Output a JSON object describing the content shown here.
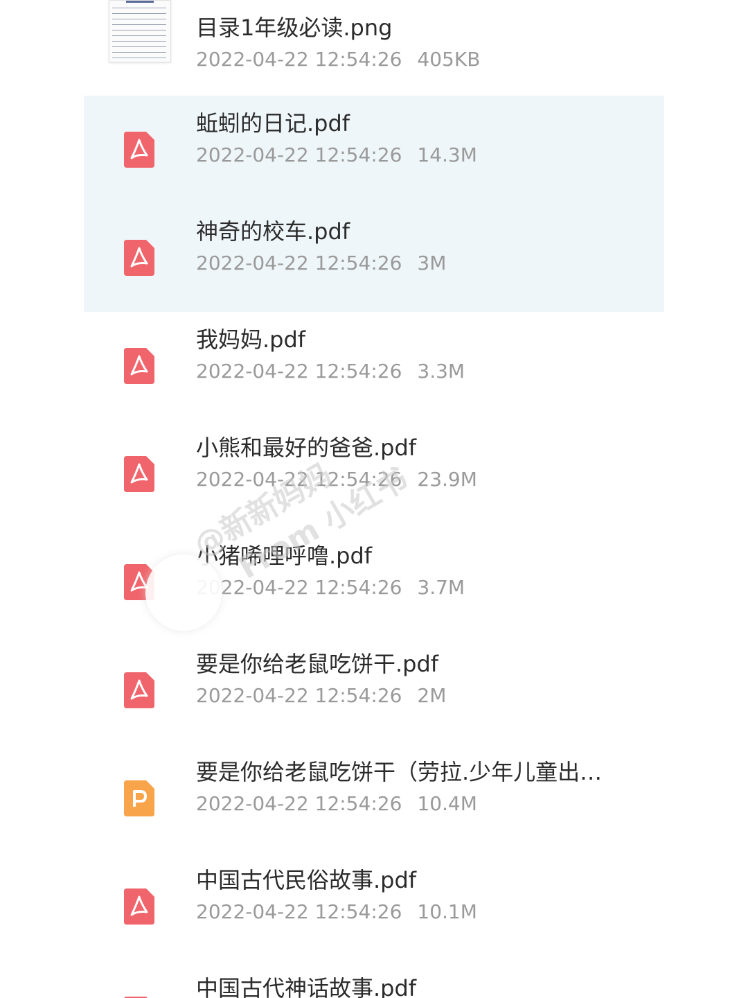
{
  "files": [
    {
      "name": "目录1年级必读.png",
      "date": "2022-04-22 12:54:26",
      "size": "405KB",
      "type": "image",
      "icon": "image-thumbnail-icon",
      "selected": false
    },
    {
      "name": "蚯蚓的日记.pdf",
      "date": "2022-04-22 12:54:26",
      "size": "14.3M",
      "type": "pdf",
      "icon": "pdf-icon",
      "selected": true
    },
    {
      "name": "神奇的校车.pdf",
      "date": "2022-04-22 12:54:26",
      "size": "3M",
      "type": "pdf",
      "icon": "pdf-icon",
      "selected": true
    },
    {
      "name": "我妈妈.pdf",
      "date": "2022-04-22 12:54:26",
      "size": "3.3M",
      "type": "pdf",
      "icon": "pdf-icon",
      "selected": false
    },
    {
      "name": "小熊和最好的爸爸.pdf",
      "date": "2022-04-22 12:54:26",
      "size": "23.9M",
      "type": "pdf",
      "icon": "pdf-icon",
      "selected": false
    },
    {
      "name": "小猪唏哩呼噜.pdf",
      "date": "2022-04-22 12:54:26",
      "size": "3.7M",
      "type": "pdf",
      "icon": "pdf-icon",
      "selected": false
    },
    {
      "name": "要是你给老鼠吃饼干.pdf",
      "date": "2022-04-22 12:54:26",
      "size": "2M",
      "type": "pdf",
      "icon": "pdf-icon",
      "selected": false
    },
    {
      "name": "要是你给老鼠吃饼干（劳拉.少年儿童出…",
      "date": "2022-04-22 12:54:26",
      "size": "10.4M",
      "type": "ppt",
      "icon": "ppt-icon",
      "selected": false
    },
    {
      "name": "中国古代民俗故事.pdf",
      "date": "2022-04-22 12:54:26",
      "size": "10.1M",
      "type": "pdf",
      "icon": "pdf-icon",
      "selected": false
    },
    {
      "name": "中国古代神话故事.pdf",
      "date": "",
      "size": "",
      "type": "pdf",
      "icon": "pdf-icon",
      "selected": false
    }
  ],
  "watermark": {
    "line1": "@新新妈妈",
    "line2": "From 小红书"
  },
  "colors": {
    "pdf": "#f0646b",
    "ppt": "#f7a44a",
    "selected_bg": "#eff6f9",
    "name_text": "#2b2b2b",
    "meta_text": "#9a9a9a"
  }
}
